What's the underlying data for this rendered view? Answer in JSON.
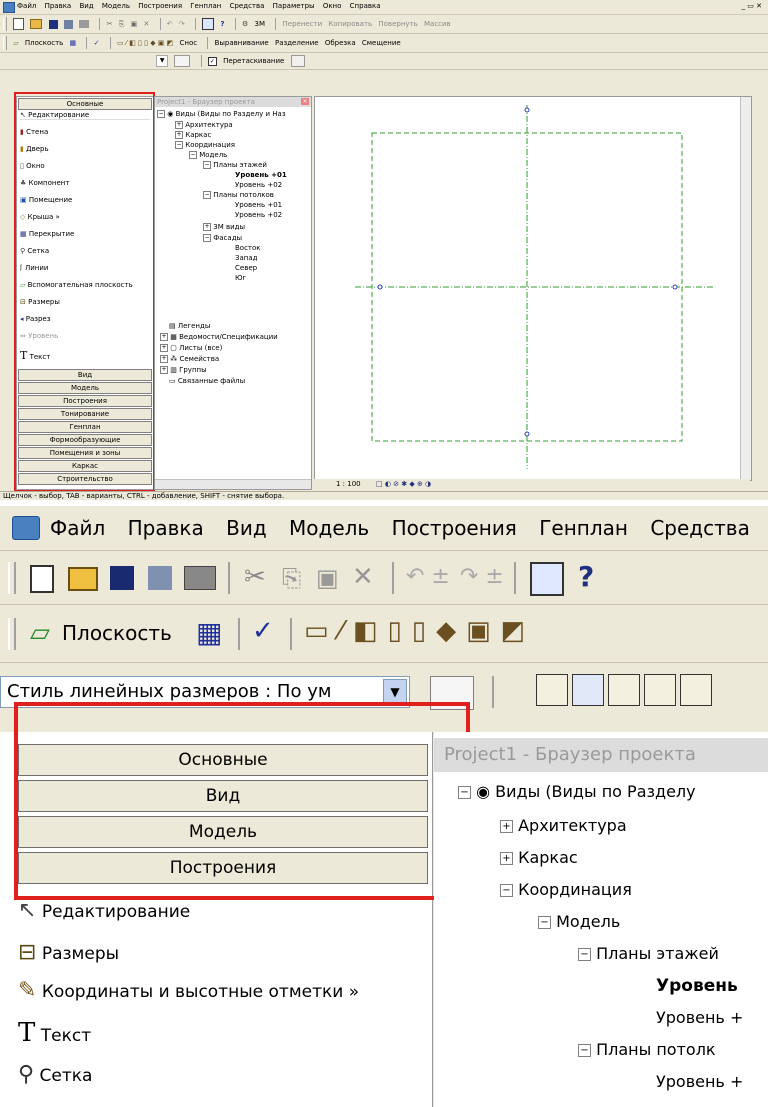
{
  "menu": [
    "Файл",
    "Правка",
    "Вид",
    "Модель",
    "Построения",
    "Генплан",
    "Средства",
    "Параметры",
    "Окно",
    "Справка"
  ],
  "zoom_menu": [
    "Файл",
    "Правка",
    "Вид",
    "Модель",
    "Построения",
    "Генплан",
    "Средства"
  ],
  "window_controls": "_ ▭ ✕",
  "toolbar1": {
    "view3d": "3М",
    "move": "Перенести",
    "copy": "Копировать",
    "rotate": "Повернуть",
    "mass": "Массив"
  },
  "toolbar2": {
    "plane": "Плоскость",
    "demolish": "Снос",
    "align": "Выравнивание",
    "split": "Разделение",
    "trim": "Обрезка",
    "offset": "Смещение"
  },
  "toolbar3": {
    "drag": "Перетаскивание"
  },
  "panel": {
    "header": "Основные",
    "items": [
      "Редактирование",
      "Стена",
      "Дверь",
      "Окно",
      "Компонент",
      "Помещение",
      "Крыша »",
      "Перекрытие",
      "Сетка",
      "Линии",
      "Вспомогательная плоскость",
      "Размеры",
      "Разрез",
      "Уровень",
      "Текст"
    ],
    "tabs": [
      "Вид",
      "Модель",
      "Построения",
      "Тонирование",
      "Генплан",
      "Формообразующие",
      "Помещения и зоны",
      "Каркас",
      "Строительство"
    ]
  },
  "browser": {
    "title": "Project1 - Браузер проекта",
    "root": "Виды (Виды по Разделу и Наз",
    "nodes": [
      "Архитектура",
      "Каркас",
      "Координация",
      "Модель",
      "Планы этажей",
      "Уровень +01",
      "Уровень +02",
      "Планы потолков",
      "Уровень +01",
      "Уровень +02",
      "3М виды",
      "Фасады",
      "Восток",
      "Запад",
      "Север",
      "Юг",
      "Легенды",
      "Ведомости/Спецификации",
      "Листы (все)",
      "Семейства",
      "Группы",
      "Связанные файлы"
    ]
  },
  "view": {
    "scale": "1 : 100"
  },
  "status": "Щелчок - выбор, TAB - варианты, CTRL - добавление, SHIFT - снятие выбора.",
  "zoom": {
    "plane": "Плоскость",
    "dim_style": "Стиль линейных размеров : По ум",
    "panel_tabs": [
      "Основные",
      "Вид",
      "Модель",
      "Построения"
    ],
    "items": [
      "Редактирование",
      "Размеры",
      "Координаты и высотные отметки »",
      "Текст",
      "Сетка"
    ],
    "browser_title": "Project1 - Браузер проекта",
    "root": "Виды (Виды по Разделу",
    "nodes": [
      "Архитектура",
      "Каркас",
      "Координация",
      "Модель",
      "Планы этажей",
      "Уровень",
      "Уровень +",
      "Планы потолк",
      "Уровень +"
    ]
  },
  "colors": {
    "accent_red": "#e0201c",
    "ui_face": "#ece9d8",
    "grid_green": "#2e9e2e",
    "grid_blue": "#3040c0"
  }
}
